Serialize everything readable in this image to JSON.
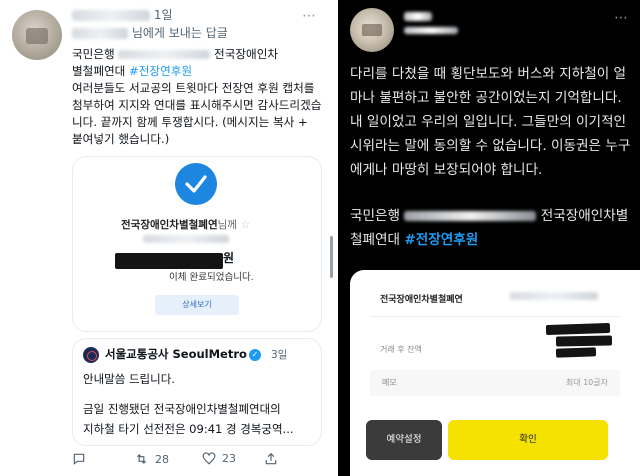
{
  "left_tweet": {
    "timestamp": "1일",
    "reply_context": "님에게 보내는 답글",
    "body_line1": "국민은행",
    "body_line1_end": "전국장애인차",
    "body_line2": "별철폐연대",
    "hashtag": "#전장연후원",
    "body_rest": "여러분들도 서교공의 트윗마다 전장연 후원 캡처를 첨부하여 지지와 연대를 표시해주시면 감사드리겠습니다. 끝까지 함께 투쟁합시다. (메시지는 복사 + 붙여넣기 했습니다.)",
    "receipt": {
      "recipient": "전국장애인차별철폐연",
      "recipient_suffix": "님께",
      "star": "☆",
      "amount_suffix": "원",
      "status": "이체 완료되었습니다.",
      "detail_button": "상세보기"
    },
    "quote": {
      "name": "서울교통공사 SeoulMetro",
      "verified": "✓",
      "time": "3일",
      "line1": "안내말씀 드립니다.",
      "line2": "금일 진행됐던 전국장애인차별철폐연대의",
      "line3": "지하철 타기 선전전은 09:41 경 경복궁역..."
    },
    "actions": {
      "retweets": "28",
      "likes": "23"
    }
  },
  "right_tweet": {
    "body": "다리를 다쳤을 때 횡단보도와 버스와 지하철이 얼마나 불편하고 불안한 공간이었는지 기억합니다. 내 일이었고 우리의 일입니다. 그들만의 이기적인 시위라는 말에 동의할 수 없습니다. 이동권은 누구에게나 마땅히 보장되어야 합니다.",
    "bank_prefix": "국민은행",
    "bank_org": "전국장애인차별철폐연대",
    "hashtag": "#전장연후원",
    "receipt": {
      "recipient": "전국장애인차별철폐연",
      "balance_label": "거래 후 잔액",
      "memo_label": "메모",
      "memo_hint": "최대 10글자",
      "schedule_button": "예약설정",
      "confirm_button": "확인"
    }
  },
  "colors": {
    "link": "#1d9bf0",
    "confirm_yellow": "#f6e200",
    "dark_bg": "#000000"
  }
}
